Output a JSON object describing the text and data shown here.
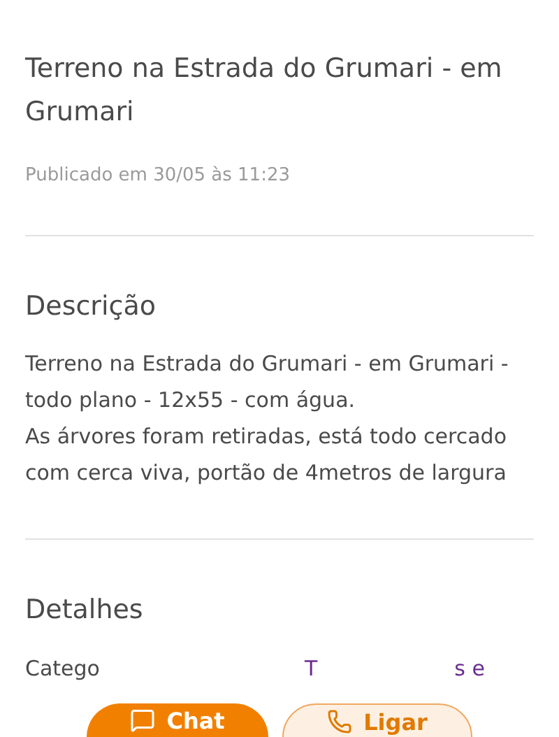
{
  "listing": {
    "title": "Terreno na Estrada do Grumari - em Grumari",
    "published": "Publicado em 30/05 às 11:23"
  },
  "description": {
    "heading": "Descrição",
    "lines": [
      "Terreno na Estrada do Grumari - em Grumari - todo plano - 12x55 - com água.",
      "As árvores foram retiradas, está todo cercado com cerca viva, portão de 4metros de largura"
    ]
  },
  "details": {
    "heading": "Detalhes",
    "rows": [
      {
        "label": "Catego",
        "value_parts": [
          "T",
          "s e"
        ]
      }
    ]
  },
  "actions": [
    {
      "label": "Chat",
      "kind": "primary"
    },
    {
      "label": "Ligar",
      "kind": "secondary"
    }
  ]
}
